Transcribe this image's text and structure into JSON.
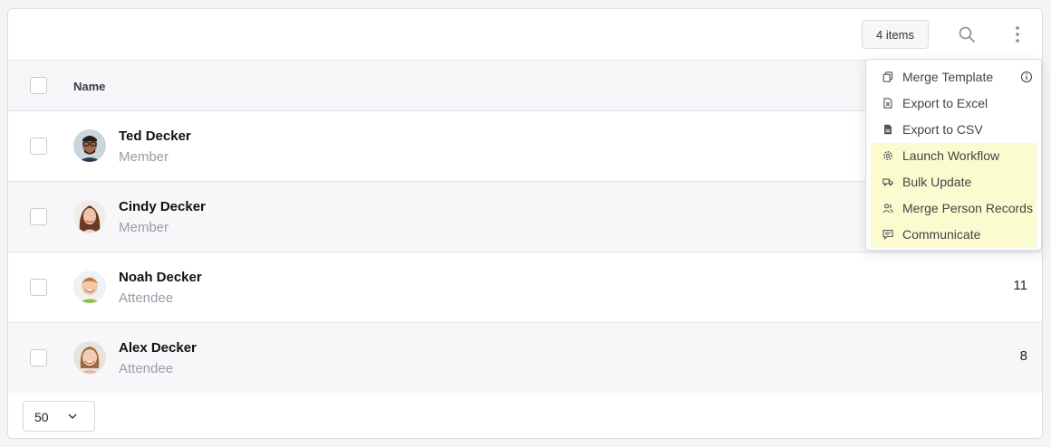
{
  "toolbar": {
    "count_label": "4 items",
    "search_icon": "search-icon",
    "more_icon": "more-vertical-icon"
  },
  "table": {
    "columns": [
      "Name"
    ],
    "rows": [
      {
        "name": "Ted Decker",
        "role": "Member",
        "value": ""
      },
      {
        "name": "Cindy Decker",
        "role": "Member",
        "value": ""
      },
      {
        "name": "Noah Decker",
        "role": "Attendee",
        "value": "11"
      },
      {
        "name": "Alex Decker",
        "role": "Attendee",
        "value": "8"
      }
    ]
  },
  "footer": {
    "page_size": "50"
  },
  "menu": {
    "items": [
      {
        "label": "Merge Template",
        "icon": "copy-icon"
      },
      {
        "label": "Export to Excel",
        "icon": "excel-file-icon"
      },
      {
        "label": "Export to CSV",
        "icon": "csv-file-icon"
      },
      {
        "label": "Launch Workflow",
        "icon": "gear-icon"
      },
      {
        "label": "Bulk Update",
        "icon": "truck-icon"
      },
      {
        "label": "Merge Person Records",
        "icon": "users-icon"
      },
      {
        "label": "Communicate",
        "icon": "message-icon"
      }
    ],
    "highlight_color": "#fafcd0"
  }
}
